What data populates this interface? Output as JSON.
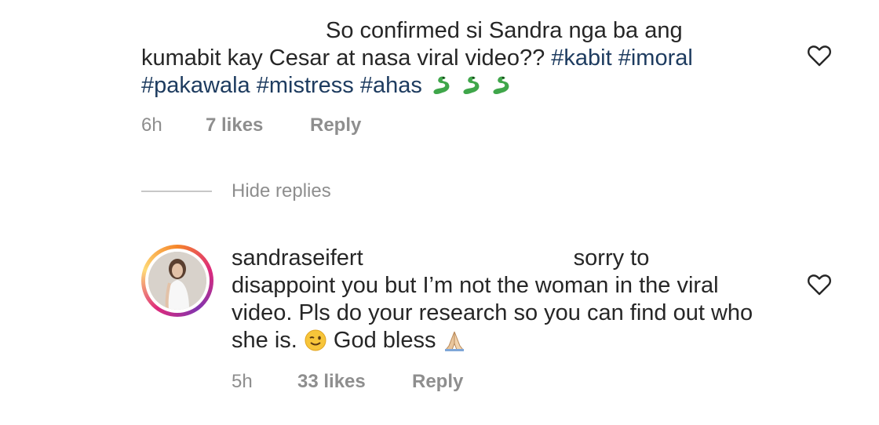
{
  "comment1": {
    "line1": "So confirmed si Sandra nga ba ang",
    "line2_text": "kumabit kay Cesar at nasa viral video?? ",
    "hashtags_line2": [
      "#kabit",
      "#imoral"
    ],
    "hashtags_line3": [
      "#pakawala",
      "#mistress",
      "#ahas"
    ],
    "time": "6h",
    "likes": "7 likes",
    "reply": "Reply"
  },
  "thread": {
    "hide_replies": "Hide replies"
  },
  "comment2": {
    "username": "sandraseifert",
    "line1": "sorry to",
    "line2": "disappoint you but I’m not the woman in the viral",
    "line3": "video. Pls do your research so you can find out who",
    "line4_before": "she is. ",
    "line4_after": " God bless ",
    "time": "5h",
    "likes": "33 likes",
    "reply": "Reply"
  },
  "colors": {
    "text": "#262626",
    "meta": "#8e8e8e",
    "hashtag": "#1d3b5f"
  },
  "icons": {
    "like": "heart-outline-icon",
    "snake": "snake-emoji",
    "wink": "winking-face-emoji",
    "pray": "folded-hands-emoji"
  }
}
